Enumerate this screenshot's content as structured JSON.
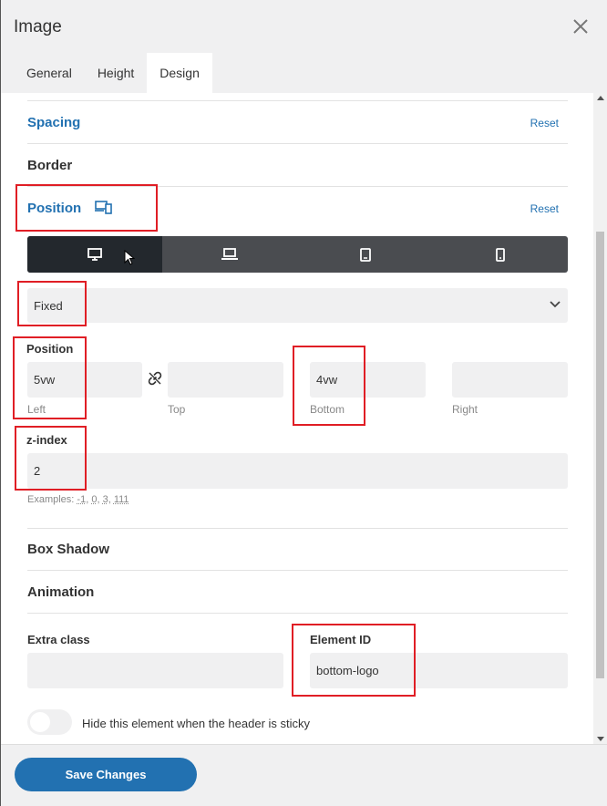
{
  "window": {
    "title": "Image"
  },
  "tabs": [
    {
      "label": "General",
      "active": false
    },
    {
      "label": "Height",
      "active": false
    },
    {
      "label": "Design",
      "active": true
    }
  ],
  "sections": {
    "spacing": {
      "title": "Spacing",
      "reset": "Reset"
    },
    "border": {
      "title": "Border"
    },
    "position": {
      "title": "Position",
      "reset": "Reset"
    },
    "box_shadow": {
      "title": "Box Shadow"
    },
    "animation": {
      "title": "Animation"
    }
  },
  "devices": [
    {
      "name": "desktop-icon",
      "active": true
    },
    {
      "name": "laptop-icon",
      "active": false
    },
    {
      "name": "tablet-icon",
      "active": false
    },
    {
      "name": "mobile-icon",
      "active": false
    }
  ],
  "position_select": {
    "value": "Fixed"
  },
  "position_fields": {
    "label": "Position",
    "left": {
      "value": "5vw",
      "label": "Left"
    },
    "top": {
      "value": "",
      "label": "Top"
    },
    "bottom": {
      "value": "4vw",
      "label": "Bottom"
    },
    "right": {
      "value": "",
      "label": "Right"
    }
  },
  "zindex": {
    "label": "z-index",
    "value": "2",
    "examples_prefix": "Examples: ",
    "examples": [
      "-1",
      "0",
      "3",
      "111"
    ]
  },
  "extra_class": {
    "label": "Extra class",
    "value": ""
  },
  "element_id": {
    "label": "Element ID",
    "value": "bottom-logo"
  },
  "sticky_toggle": {
    "label": "Hide this element when the header is sticky",
    "on": false
  },
  "footer": {
    "save_label": "Save Changes"
  },
  "colors": {
    "accent": "#2271b1",
    "highlight": "#e01e25",
    "device_bar": "#4a4c50",
    "device_active": "#23282d"
  }
}
